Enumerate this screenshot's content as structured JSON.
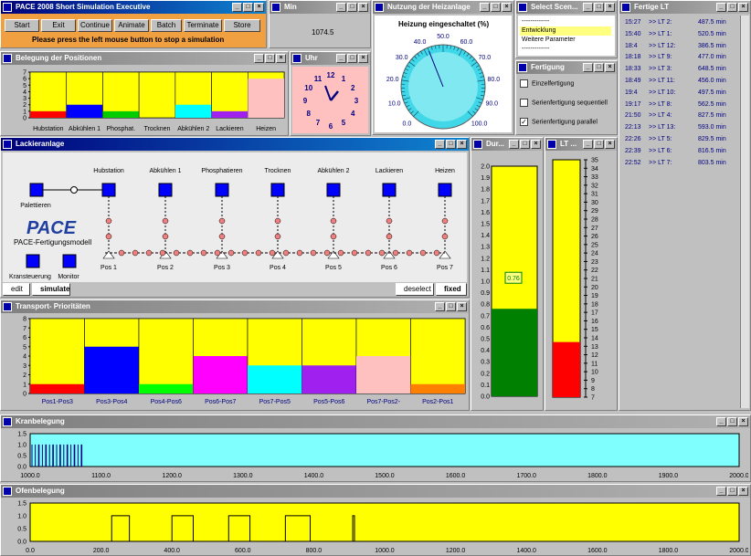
{
  "main_win": {
    "title": "PACE 2008   Short Simulation Executive",
    "buttons": [
      "Start",
      "Exit",
      "Continue",
      "Animate",
      "Batch",
      "Terminate",
      "Store"
    ],
    "hint": "Please press the left mouse button to stop a simulation"
  },
  "min_win": {
    "title": "Min",
    "value": "1074.5"
  },
  "nutzung_win": {
    "title": "Nutzung der Heizanlage",
    "gauge_title": "Heizung eingeschaltet (%)",
    "ticks": [
      "0.0",
      "10.0",
      "20.0",
      "30.0",
      "40.0",
      "50.0",
      "60.0",
      "70.0",
      "80.0",
      "90.0",
      "100.0"
    ],
    "value_pct": 42
  },
  "select_win": {
    "title": "Select Scen...",
    "items": [
      "-------------",
      "Entwicklung",
      "Weitere Parameter",
      "-------------"
    ],
    "selected": 1
  },
  "fertigung_win": {
    "title": "Fertigung",
    "options": [
      {
        "label": "Einzelfertigung",
        "checked": false
      },
      {
        "label": "Serienfertigung sequentiell",
        "checked": false
      },
      {
        "label": "Serienfertigung parallel",
        "checked": true
      }
    ]
  },
  "fertige_win": {
    "title": "Fertige LT",
    "rows": [
      [
        "15:27",
        ">> LT 2:",
        "487.5 min"
      ],
      [
        "15:40",
        ">> LT 1:",
        "520.5 min"
      ],
      [
        "18:4",
        ">> LT 12:",
        "386.5 min"
      ],
      [
        "18:18",
        ">> LT 9:",
        "477.0 min"
      ],
      [
        "18:33",
        ">> LT 3:",
        "648.5 min"
      ],
      [
        "18:49",
        ">> LT 11:",
        "456.0 min"
      ],
      [
        "19:4",
        ">> LT 10:",
        "497.5 min"
      ],
      [
        "19:17",
        ">> LT 8:",
        "562.5 min"
      ],
      [
        "21:50",
        ">> LT 4:",
        "827.5 min"
      ],
      [
        "22:13",
        ">> LT 13:",
        "593.0 min"
      ],
      [
        "22:26",
        ">> LT 5:",
        "829.5 min"
      ],
      [
        "22:39",
        ">> LT 6:",
        "816.5 min"
      ],
      [
        "22:52",
        ">> LT 7:",
        "803.5 min"
      ]
    ]
  },
  "belegung_win": {
    "title": "Belegung der Positionen",
    "yticks": [
      "0",
      "1",
      "2",
      "3",
      "4",
      "5",
      "6",
      "7"
    ],
    "bars": [
      {
        "label": "Hubstation",
        "color": "#ff0000",
        "fill": 1.0
      },
      {
        "label": "Abkühlen 1",
        "color": "#0000ff",
        "fill": 2.0
      },
      {
        "label": "Phosphat.",
        "color": "#00cc00",
        "fill": 1.0
      },
      {
        "label": "Trocknen",
        "color": "#ffff00",
        "fill": 0
      },
      {
        "label": "Abkühlen 2",
        "color": "#00ffff",
        "fill": 2.0
      },
      {
        "label": "Lackieren",
        "color": "#a020f0",
        "fill": 1.0
      },
      {
        "label": "Heizen",
        "color": "#ffc0c0",
        "fill": 6.0
      }
    ]
  },
  "uhr_win": {
    "title": "Uhr",
    "numbers": [
      "12",
      "1",
      "2",
      "3",
      "4",
      "5",
      "6",
      "7",
      "8",
      "9",
      "10",
      "11"
    ]
  },
  "lackier_win": {
    "title": "Lackieranlage",
    "stations": [
      "Hubstation",
      "Abkühlen 1",
      "Phosphatieren",
      "Trocknen",
      "Abkühlen 2",
      "Lackieren",
      "Heizen"
    ],
    "positions": [
      "Pos 1",
      "Pos 2",
      "Pos 3",
      "Pos 4",
      "Pos 5",
      "Pos 6",
      "Pos 7"
    ],
    "paletten": "Palettieren",
    "logo": "PACE",
    "logo_sub": "PACE-Fertigungsmodell",
    "kran": "Kransteuerung",
    "monitor": "Monitor",
    "btn_edit": "edit",
    "btn_simulate": "simulate",
    "btn_deselect": "deselect",
    "btn_fixed": "fixed"
  },
  "dur_win": {
    "title": "Dur...",
    "yticks": [
      "0.0",
      "0.1",
      "0.2",
      "0.3",
      "0.4",
      "0.5",
      "0.6",
      "0.7",
      "0.8",
      "0.9",
      "1.0",
      "1.1",
      "1.2",
      "1.3",
      "1.4",
      "1.5",
      "1.6",
      "1.7",
      "1.8",
      "1.9",
      "2.0"
    ],
    "value": 0.76,
    "value_label": "0.76"
  },
  "lt_win": {
    "title": "LT ...",
    "yticks": [
      "7",
      "8",
      "9",
      "10",
      "11",
      "12",
      "13",
      "14",
      "15",
      "16",
      "17",
      "18",
      "19",
      "20",
      "21",
      "22",
      "23",
      "24",
      "25",
      "26",
      "27",
      "28",
      "29",
      "30",
      "31",
      "32",
      "33",
      "34",
      "35"
    ],
    "value": 13.5
  },
  "transport_win": {
    "title": "Transport- Prioritäten",
    "yticks": [
      "0",
      "1",
      "2",
      "3",
      "4",
      "5",
      "6",
      "7",
      "8"
    ],
    "bars": [
      {
        "label": "Pos1-Pos3",
        "color": "#ff0000",
        "fill": 1.0
      },
      {
        "label": "Pos3-Pos4",
        "color": "#0000ff",
        "fill": 5.0
      },
      {
        "label": "Pos4-Pos6",
        "color": "#00ff00",
        "fill": 1.0
      },
      {
        "label": "Pos6-Pos7",
        "color": "#ff00ff",
        "fill": 4.0
      },
      {
        "label": "Pos7-Pos5",
        "color": "#00ffff",
        "fill": 3.0
      },
      {
        "label": "Pos5-Pos6",
        "color": "#a020f0",
        "fill": 3.0
      },
      {
        "label": "Pos7-Pos2-",
        "color": "#ffc0c0",
        "fill": 4.0
      },
      {
        "label": "Pos2-Pos1",
        "color": "#ff8000",
        "fill": 1.0
      }
    ]
  },
  "kran_win": {
    "title": "Kranbelegung",
    "yticks": [
      "0.0",
      "0.5",
      "1.0",
      "1.5"
    ],
    "xticks": [
      "1000.0",
      "1100.0",
      "1200.0",
      "1300.0",
      "1400.0",
      "1500.0",
      "1600.0",
      "1700.0",
      "1800.0",
      "1900.0",
      "2000.0"
    ]
  },
  "ofen_win": {
    "title": "Ofenbelegung",
    "yticks": [
      "0.0",
      "0.5",
      "1.0",
      "1.5"
    ],
    "xticks": [
      "0.0",
      "200.0",
      "400.0",
      "600.0",
      "800.0",
      "1000.0",
      "1200.0",
      "1400.0",
      "1600.0",
      "1800.0",
      "2000.0"
    ]
  },
  "colors": {
    "yellow": "#ffff00",
    "cyan": "#80ffff",
    "green": "#008000",
    "red": "#ff0000"
  }
}
